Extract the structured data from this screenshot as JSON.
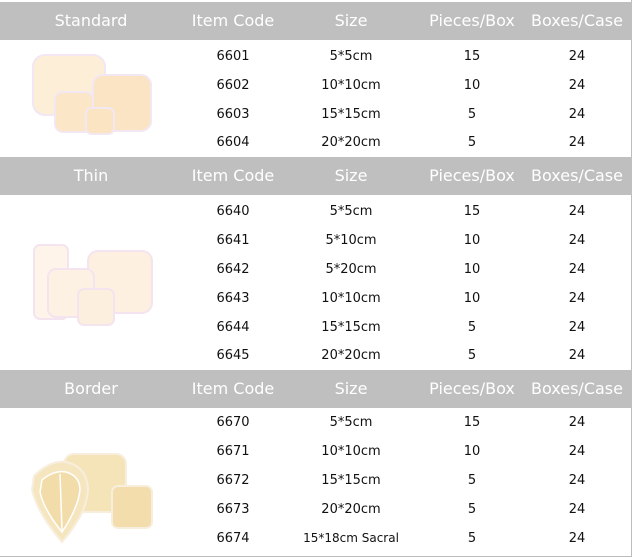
{
  "colors": {
    "header_bg": "#bfbfbf",
    "header_text": "#ffffff",
    "pad_fill": "#fbe8cc",
    "pad_border_fill": "#f2dda8"
  },
  "columns": {
    "item_code": "Item Code",
    "size": "Size",
    "pieces_per_box": "Pieces/Box",
    "boxes_per_case": "Boxes/Case"
  },
  "sections": [
    {
      "name": "Standard",
      "image_icon": "standard-dressing-icon",
      "rows": [
        {
          "code": "6601",
          "size": "5*5cm",
          "pieces": "15",
          "boxes": "24"
        },
        {
          "code": "6602",
          "size": "10*10cm",
          "pieces": "10",
          "boxes": "24"
        },
        {
          "code": "6603",
          "size": "15*15cm",
          "pieces": "5",
          "boxes": "24"
        },
        {
          "code": "6604",
          "size": "20*20cm",
          "pieces": "5",
          "boxes": "24"
        }
      ]
    },
    {
      "name": "Thin",
      "image_icon": "thin-dressing-icon",
      "rows": [
        {
          "code": "6640",
          "size": "5*5cm",
          "pieces": "15",
          "boxes": "24"
        },
        {
          "code": "6641",
          "size": "5*10cm",
          "pieces": "10",
          "boxes": "24"
        },
        {
          "code": "6642",
          "size": "5*20cm",
          "pieces": "10",
          "boxes": "24"
        },
        {
          "code": "6643",
          "size": "10*10cm",
          "pieces": "10",
          "boxes": "24"
        },
        {
          "code": "6644",
          "size": "15*15cm",
          "pieces": "5",
          "boxes": "24"
        },
        {
          "code": "6645",
          "size": "20*20cm",
          "pieces": "5",
          "boxes": "24"
        }
      ]
    },
    {
      "name": "Border",
      "image_icon": "border-dressing-icon",
      "rows": [
        {
          "code": "6670",
          "size": "5*5cm",
          "pieces": "15",
          "boxes": "24"
        },
        {
          "code": "6671",
          "size": "10*10cm",
          "pieces": "10",
          "boxes": "24"
        },
        {
          "code": "6672",
          "size": "15*15cm",
          "pieces": "5",
          "boxes": "24"
        },
        {
          "code": "6673",
          "size": "20*20cm",
          "pieces": "5",
          "boxes": "24"
        },
        {
          "code": "6674",
          "size": "15*18cm Sacral",
          "pieces": "5",
          "boxes": "24"
        }
      ]
    }
  ]
}
